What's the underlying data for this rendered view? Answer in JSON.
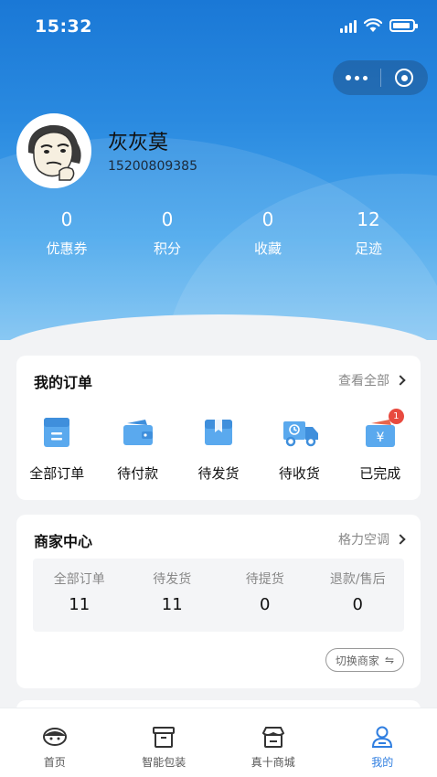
{
  "status_bar": {
    "time": "15:32"
  },
  "profile": {
    "name": "灰灰莫",
    "phone": "15200809385"
  },
  "stats": [
    {
      "value": "0",
      "label": "优惠券"
    },
    {
      "value": "0",
      "label": "积分"
    },
    {
      "value": "0",
      "label": "收藏"
    },
    {
      "value": "12",
      "label": "足迹"
    }
  ],
  "orders": {
    "title": "我的订单",
    "view_all": "查看全部",
    "items": [
      {
        "label": "全部订单",
        "icon": "all-orders-icon"
      },
      {
        "label": "待付款",
        "icon": "wallet-icon"
      },
      {
        "label": "待发货",
        "icon": "package-icon"
      },
      {
        "label": "待收货",
        "icon": "truck-icon"
      },
      {
        "label": "已完成",
        "icon": "completed-icon",
        "badge": "1"
      }
    ]
  },
  "merchant": {
    "title": "商家中心",
    "store": "格力空调",
    "stats": [
      {
        "label": "全部订单",
        "value": "11"
      },
      {
        "label": "待发货",
        "value": "11"
      },
      {
        "label": "待提货",
        "value": "0"
      },
      {
        "label": "退款/售后",
        "value": "0"
      }
    ],
    "switch_label": "切换商家"
  },
  "tabbar": [
    {
      "label": "首页",
      "icon": "home-icon"
    },
    {
      "label": "智能包装",
      "icon": "box-icon"
    },
    {
      "label": "真十商城",
      "icon": "store-icon"
    },
    {
      "label": "我的",
      "icon": "user-icon",
      "active": true
    }
  ],
  "colors": {
    "accent": "#2f7ee0",
    "hero_top": "#1a78d6",
    "badge": "#e84a3f",
    "icon_blue": "#5aa9ee"
  }
}
